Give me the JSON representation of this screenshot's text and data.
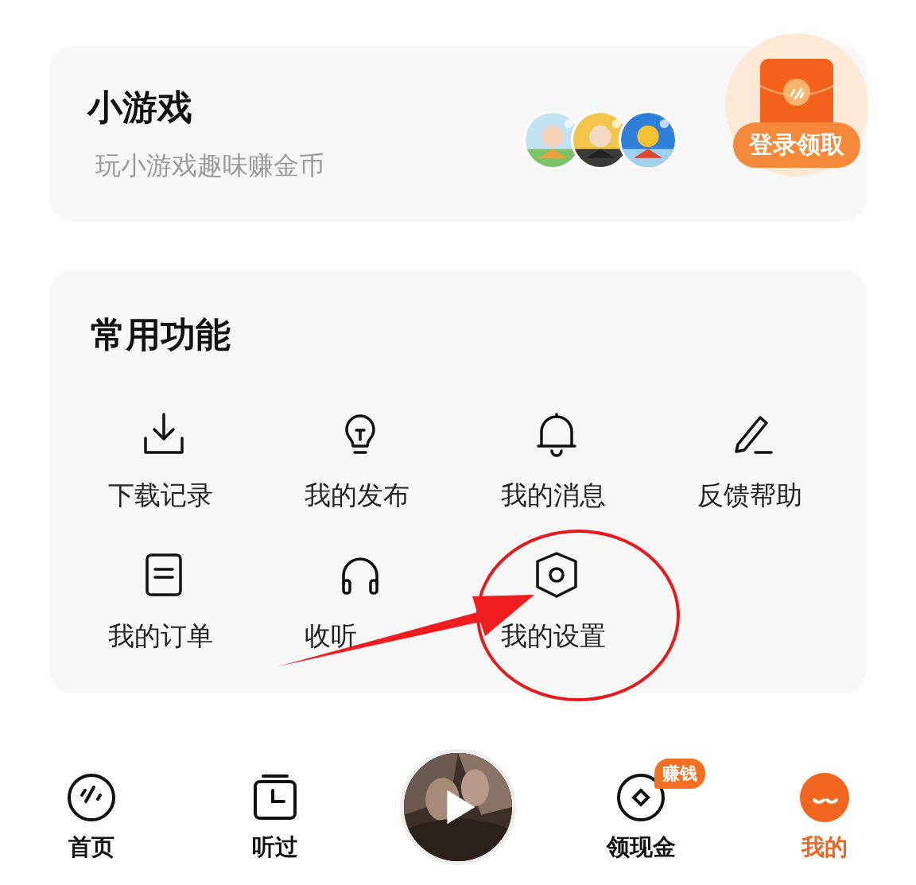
{
  "mini_games": {
    "title": "小游戏",
    "subtitle": "玩小游戏趣味赚金币",
    "promo": {
      "label": "登录领取"
    }
  },
  "common_functions": {
    "title": "常用功能",
    "items": [
      {
        "label": "下载记录"
      },
      {
        "label": "我的发布"
      },
      {
        "label": "我的消息"
      },
      {
        "label": "反馈帮助"
      },
      {
        "label": "我的订单"
      },
      {
        "label": "收听"
      },
      {
        "label": "我的设置"
      }
    ]
  },
  "bottom_nav": [
    {
      "kind": "tab",
      "label": "首页",
      "selected": false
    },
    {
      "kind": "tab",
      "label": "听过",
      "selected": false
    },
    {
      "kind": "player"
    },
    {
      "kind": "tab",
      "label": "领现金",
      "badge": "赚钱",
      "selected": false
    },
    {
      "kind": "tab",
      "label": "我的",
      "selected": true
    }
  ]
}
